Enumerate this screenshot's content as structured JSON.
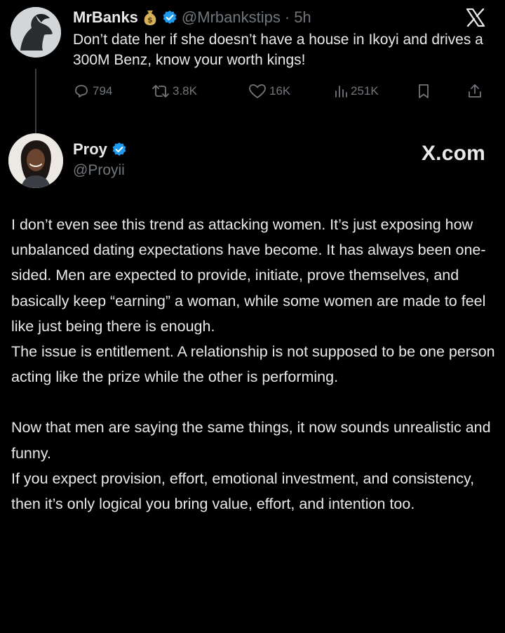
{
  "tweet1": {
    "name": "MrBanks",
    "handle": "@Mrbankstips",
    "separator": "·",
    "time": "5h",
    "text": "Don’t date her if she doesn’t have a house in Ikoyi and drives a 300M Benz, know your worth kings!",
    "actions": {
      "replies": "794",
      "reposts": "3.8K",
      "likes": "16K",
      "views": "251K"
    },
    "icons": [
      "money-bag-icon",
      "verified-icon",
      "x-logo-icon",
      "reply-icon",
      "repost-icon",
      "like-icon",
      "views-icon",
      "bookmark-icon",
      "share-icon"
    ]
  },
  "tweet2": {
    "name": "Proy",
    "handle": "@Proyii",
    "watermark": "X.com",
    "paragraphs": [
      "I don’t even see this trend as attacking women. It’s just exposing how unbalanced dating expectations have become. It has always been one-sided. Men are expected to provide, initiate, prove themselves, and basically keep “earning” a woman, while some women are made to feel like just being there is enough.",
      "The issue is entitlement. A relationship is not supposed to be one person acting like the prize while the other is performing.",
      "Now that men are saying the same things, it now sounds unrealistic and funny.",
      "If you expect provision, effort, emotional investment, and consistency, then it’s only logical you bring value, effort, and intention too."
    ]
  },
  "colors": {
    "background": "#000000",
    "text": "#e7e9ea",
    "muted": "#71767b",
    "verified": "#1d9bf0"
  }
}
